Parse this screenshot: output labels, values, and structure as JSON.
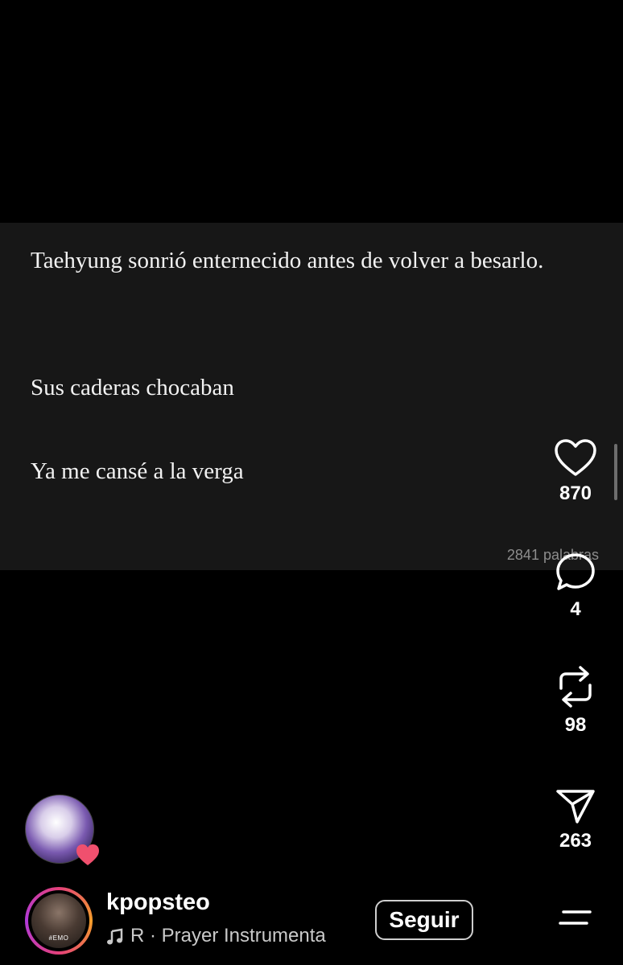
{
  "story": {
    "paragraphs": [
      "Taehyung sonrió enternecido antes de volver a besarlo.",
      "Sus caderas chocaban",
      "Ya me cansé a la verga"
    ],
    "word_count": "2841 palabras"
  },
  "actions": {
    "likes": "870",
    "comments": "4",
    "reposts": "98",
    "shares": "263"
  },
  "author": {
    "username": "kpopsteo",
    "avatar_tag": "#EMO",
    "music": "R · Prayer Instrumenta",
    "follow_label": "Seguir"
  },
  "icons": {
    "like": "heart-outline-icon",
    "comment": "speech-bubble-icon",
    "repost": "repost-arrows-icon",
    "share": "paper-plane-icon",
    "music": "music-note-icon",
    "menu": "menu-lines-icon",
    "badge": "heart-badge-icon"
  },
  "colors": {
    "background": "#000000",
    "card": "#171717",
    "badge_heart": "#f0506e"
  }
}
